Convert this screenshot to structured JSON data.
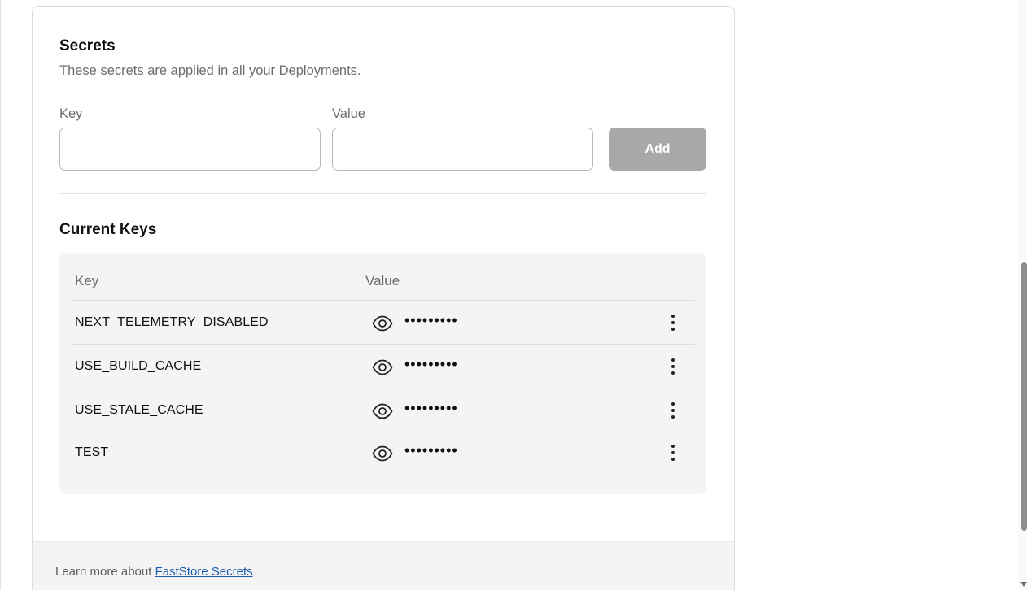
{
  "secrets": {
    "title": "Secrets",
    "subtitle": "These secrets are applied in all your Deployments."
  },
  "form": {
    "key_label": "Key",
    "key_value": "",
    "value_label": "Value",
    "value_value": "",
    "add_label": "Add"
  },
  "current_keys": {
    "title": "Current Keys",
    "columns": [
      "Key",
      "Value"
    ],
    "rows": [
      {
        "key": "NEXT_TELEMETRY_DISABLED",
        "value": "•••••••••"
      },
      {
        "key": "USE_BUILD_CACHE",
        "value": "•••••••••"
      },
      {
        "key": "USE_STALE_CACHE",
        "value": "•••••••••"
      },
      {
        "key": "TEST",
        "value": "•••••••••"
      }
    ]
  },
  "footer": {
    "text": "Learn more about",
    "link": "FastStore Secrets"
  },
  "icons": {
    "reveal": "eye-icon",
    "row_menu": "more-vertical-icon"
  },
  "colors": {
    "button_disabled": "#a8a8a8",
    "link": "#1f5eb0",
    "panel_bg": "#f4f4f4"
  }
}
